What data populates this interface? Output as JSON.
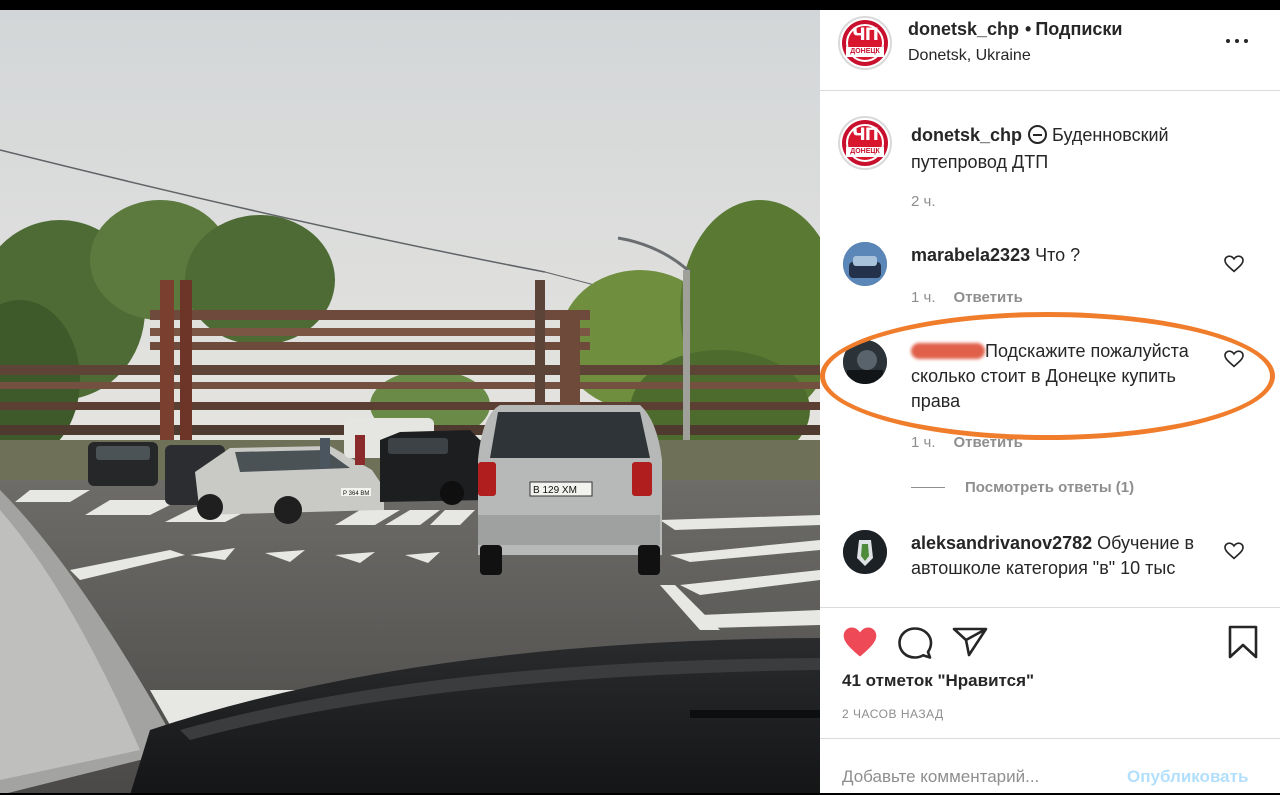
{
  "header": {
    "username": "donetsk_chp",
    "separator": "•",
    "follow_label": "Подписки",
    "location": "Donetsk, Ukraine",
    "avatar_text_big": "ЧП",
    "avatar_text_small": "ДОНЕЦК"
  },
  "caption": {
    "username": "donetsk_chp",
    "text": "Буденновский путепровод ДТП",
    "time": "2 ч."
  },
  "comments": [
    {
      "username": "marabela2323",
      "text": "Что ?",
      "time": "1 ч.",
      "reply_label": "Ответить"
    },
    {
      "username": "",
      "text": "Подскажите пожалуйста сколько стоит в Донецке купить права",
      "time": "1 ч.",
      "reply_label": "Ответить"
    },
    {
      "username": "aleksandrivanov2782",
      "text": "Обучение в автошколе категория \"в\" 10 тыс"
    }
  ],
  "view_replies": "Посмотреть ответы (1)",
  "likes": "41 отметок \"Нравится\"",
  "time_ago": "2 ЧАСОВ НАЗАД",
  "comment_input": {
    "placeholder": "Добавьте комментарий...",
    "publish_label": "Опубликовать"
  },
  "photo": {
    "plate_main": "В 129 ХМ",
    "plate_left": "Р 364 ВМ"
  },
  "colors": {
    "like_active": "#ed4956",
    "publish_disabled": "#b2dffc",
    "highlight_annotation": "#f07d2b",
    "brand_red": "#c8102e"
  }
}
